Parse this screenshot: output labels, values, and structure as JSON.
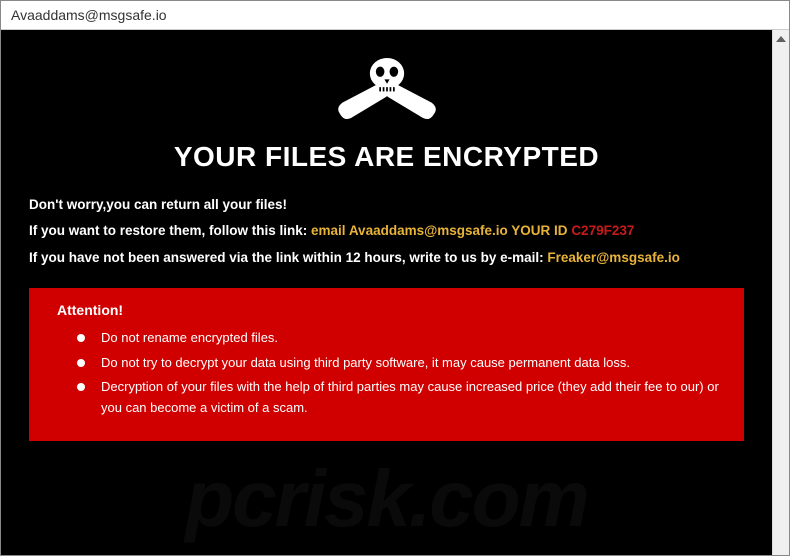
{
  "window": {
    "title": "Avaaddams@msgsafe.io"
  },
  "headline": "YOUR FILES ARE ENCRYPTED",
  "lines": {
    "l1": "Don't worry,you can return all your files!",
    "l2_prefix": "If you want to restore them, follow this link: ",
    "l2_email_label": "email ",
    "l2_email": "Avaaddams@msgsafe.io",
    "l2_yourid_label": " YOUR ID ",
    "l2_id": "C279F237",
    "l3_prefix": "If you have not been answered via the link within 12 hours, write to us by e-mail: ",
    "l3_email": "Freaker@msgsafe.io"
  },
  "attention": {
    "title": "Attention!",
    "items": [
      "Do not rename encrypted files.",
      "Do not try to decrypt your data using third party software, it may cause permanent data loss.",
      "Decryption of your files with the help of third parties may cause increased price (they add their fee to our) or you can become a victim of a scam."
    ]
  },
  "watermark": "pcrisk.com"
}
